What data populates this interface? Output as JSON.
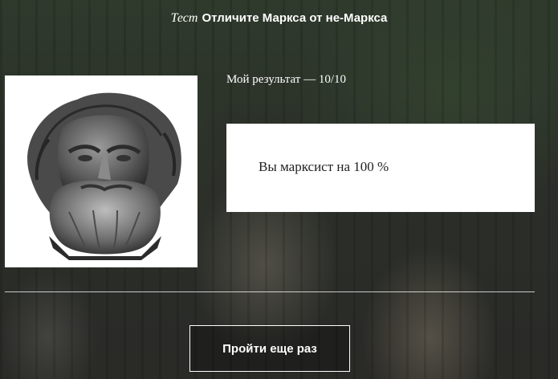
{
  "header": {
    "test_label": "Тест",
    "title": "Отличите Маркса от не-Маркса"
  },
  "result": {
    "label": "Мой результат — 10/10",
    "text": "Вы марксист на 100 %"
  },
  "retry_button": {
    "label": "Пройти еще раз"
  }
}
